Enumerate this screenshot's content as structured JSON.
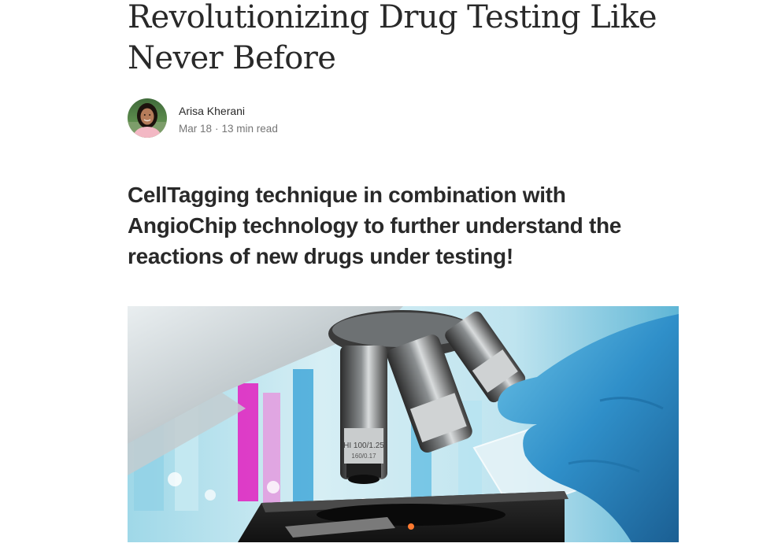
{
  "article": {
    "title": "Revolutionizing Drug Testing Like Never Before",
    "subtitle": "CellTagging technique in combination with AngioChip technology to further understand the reactions of new drugs under testing!",
    "author": {
      "name": "Arisa Kherani",
      "avatar_icon": "author-avatar-photo"
    },
    "meta": {
      "date": "Mar 18",
      "separator": "·",
      "read_time": "13 min read"
    },
    "hero_image": {
      "kind": "photo",
      "objective_marking": "HI 100/1.25",
      "objective_marking_2": "160/0.17"
    }
  },
  "colors": {
    "text_primary": "#292929",
    "text_secondary": "#757575",
    "background": "#ffffff",
    "glove_blue": "#2f8fc9",
    "tube_magenta": "#e21fbf"
  }
}
